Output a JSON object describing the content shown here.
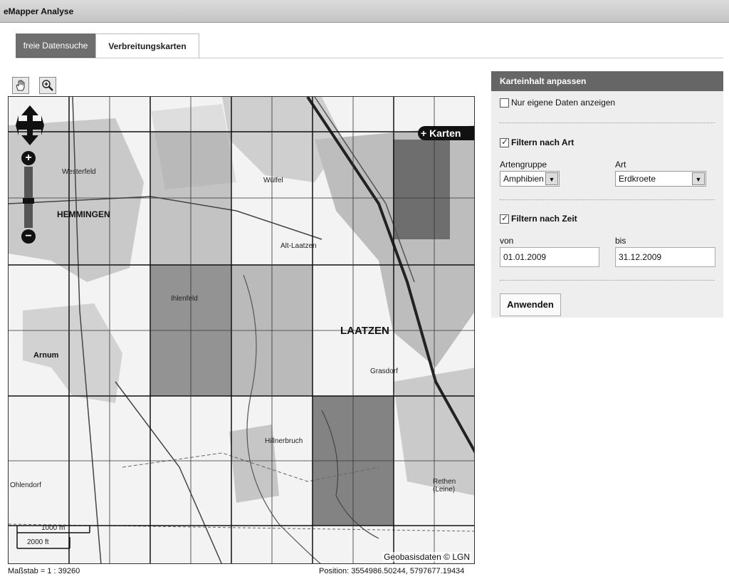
{
  "app": {
    "title": "eMapper Analyse"
  },
  "tabs": [
    {
      "label": "freie Datensuche",
      "active": false
    },
    {
      "label": "Verbreitungskarten",
      "active": true
    }
  ],
  "toolbar": {
    "pan_icon": "hand-icon",
    "zoom_icon": "zoom-in-icon"
  },
  "map": {
    "places": [
      "Westerfeld",
      "HEMMINGEN",
      "Wülfel",
      "Alt-Laatzen",
      "LAATZEN",
      "Arnum",
      "Grasdorf",
      "Rethen (Leine)",
      "Ihlenfeld",
      "Hillnerbruch",
      "Ohlendorf"
    ],
    "karten_button": "+ Karten",
    "scale_metric": "1000 m",
    "scale_imperial": "2000 ft",
    "copyright": "Geobasisdaten © LGN"
  },
  "status": {
    "scale": "Maßstab = 1 : 39260",
    "position": "Position: 3554986.50244, 5797677.19434"
  },
  "panel": {
    "title": "Karteinhalt anpassen",
    "own_data": {
      "label": "Nur eigene Daten anzeigen",
      "checked": false
    },
    "filter_art": {
      "label": "Filtern nach Art",
      "checked": true
    },
    "artengruppe_label": "Artengruppe",
    "artengruppe_value": "Amphibien",
    "art_label": "Art",
    "art_value": "Erdkroete",
    "filter_zeit": {
      "label": "Filtern nach Zeit",
      "checked": true
    },
    "von_label": "von",
    "von_value": "01.01.2009",
    "bis_label": "bis",
    "bis_value": "31.12.2009",
    "apply_label": "Anwenden"
  },
  "colors": {
    "header": "#666666",
    "tab_active_bg": "#6e6e6e",
    "panel_bg": "#eeeeee"
  }
}
